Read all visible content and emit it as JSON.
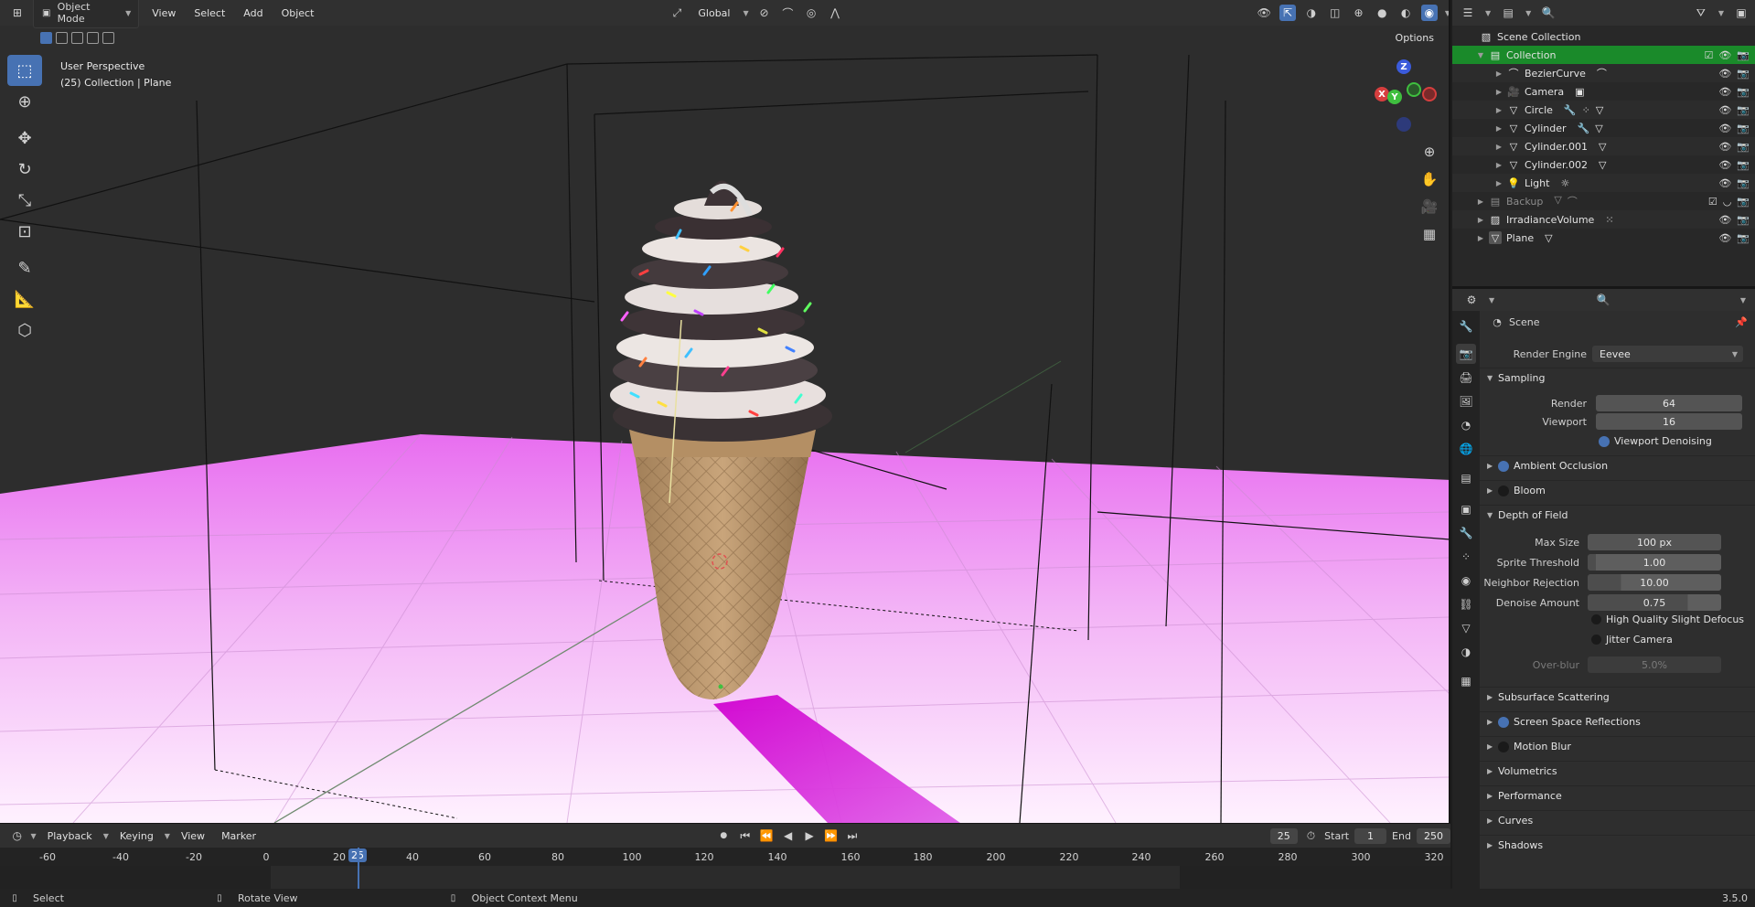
{
  "viewport": {
    "mode_label": "Object Mode",
    "menus": [
      "View",
      "Select",
      "Add",
      "Object"
    ],
    "transform_orientation": "Global",
    "options_label": "Options",
    "info_line1": "User Perspective",
    "info_line2": "(25) Collection | Plane",
    "gizmo_axes": {
      "x": "X",
      "y": "Y",
      "z": "Z"
    }
  },
  "timeline": {
    "menus": [
      "Playback",
      "Keying",
      "View",
      "Marker"
    ],
    "current_frame": "25",
    "start_label": "Start",
    "start_value": "1",
    "end_label": "End",
    "end_value": "250",
    "ruler_ticks": [
      "-60",
      "-40",
      "-20",
      "0",
      "20",
      "40",
      "60",
      "80",
      "100",
      "120",
      "140",
      "160",
      "180",
      "200",
      "220",
      "240",
      "260",
      "280",
      "300",
      "320"
    ],
    "playhead_label": "25"
  },
  "status": {
    "select": "Select",
    "rotate": "Rotate View",
    "context": "Object Context Menu",
    "version": "3.5.0"
  },
  "outliner": {
    "root": "Scene Collection",
    "collection": "Collection",
    "items": [
      {
        "name": "BezierCurve",
        "icon": "curve-icon"
      },
      {
        "name": "Camera",
        "icon": "camera-icon"
      },
      {
        "name": "Circle",
        "icon": "mesh-icon"
      },
      {
        "name": "Cylinder",
        "icon": "mesh-icon"
      },
      {
        "name": "Cylinder.001",
        "icon": "mesh-icon"
      },
      {
        "name": "Cylinder.002",
        "icon": "mesh-icon"
      },
      {
        "name": "Light",
        "icon": "light-icon"
      }
    ],
    "backup": "Backup",
    "irradiance": "IrradianceVolume",
    "plane": "Plane"
  },
  "properties": {
    "context": "Scene",
    "render_engine_label": "Render Engine",
    "render_engine_value": "Eevee",
    "sampling": {
      "title": "Sampling",
      "render_label": "Render",
      "render_value": "64",
      "viewport_label": "Viewport",
      "viewport_value": "16",
      "denoise_label": "Viewport Denoising"
    },
    "ambient_occlusion": "Ambient Occlusion",
    "bloom": "Bloom",
    "dof": {
      "title": "Depth of Field",
      "max_size_label": "Max Size",
      "max_size_value": "100 px",
      "sprite_label": "Sprite Threshold",
      "sprite_value": "1.00",
      "neighbor_label": "Neighbor Rejection",
      "neighbor_value": "10.00",
      "denoise_label": "Denoise Amount",
      "denoise_value": "0.75",
      "hq_label": "High Quality Slight Defocus",
      "jitter_label": "Jitter Camera",
      "overblur_label": "Over-blur",
      "overblur_value": "5.0%"
    },
    "sections": [
      "Subsurface Scattering",
      "Screen Space Reflections",
      "Motion Blur",
      "Volumetrics",
      "Performance",
      "Curves",
      "Shadows"
    ]
  }
}
